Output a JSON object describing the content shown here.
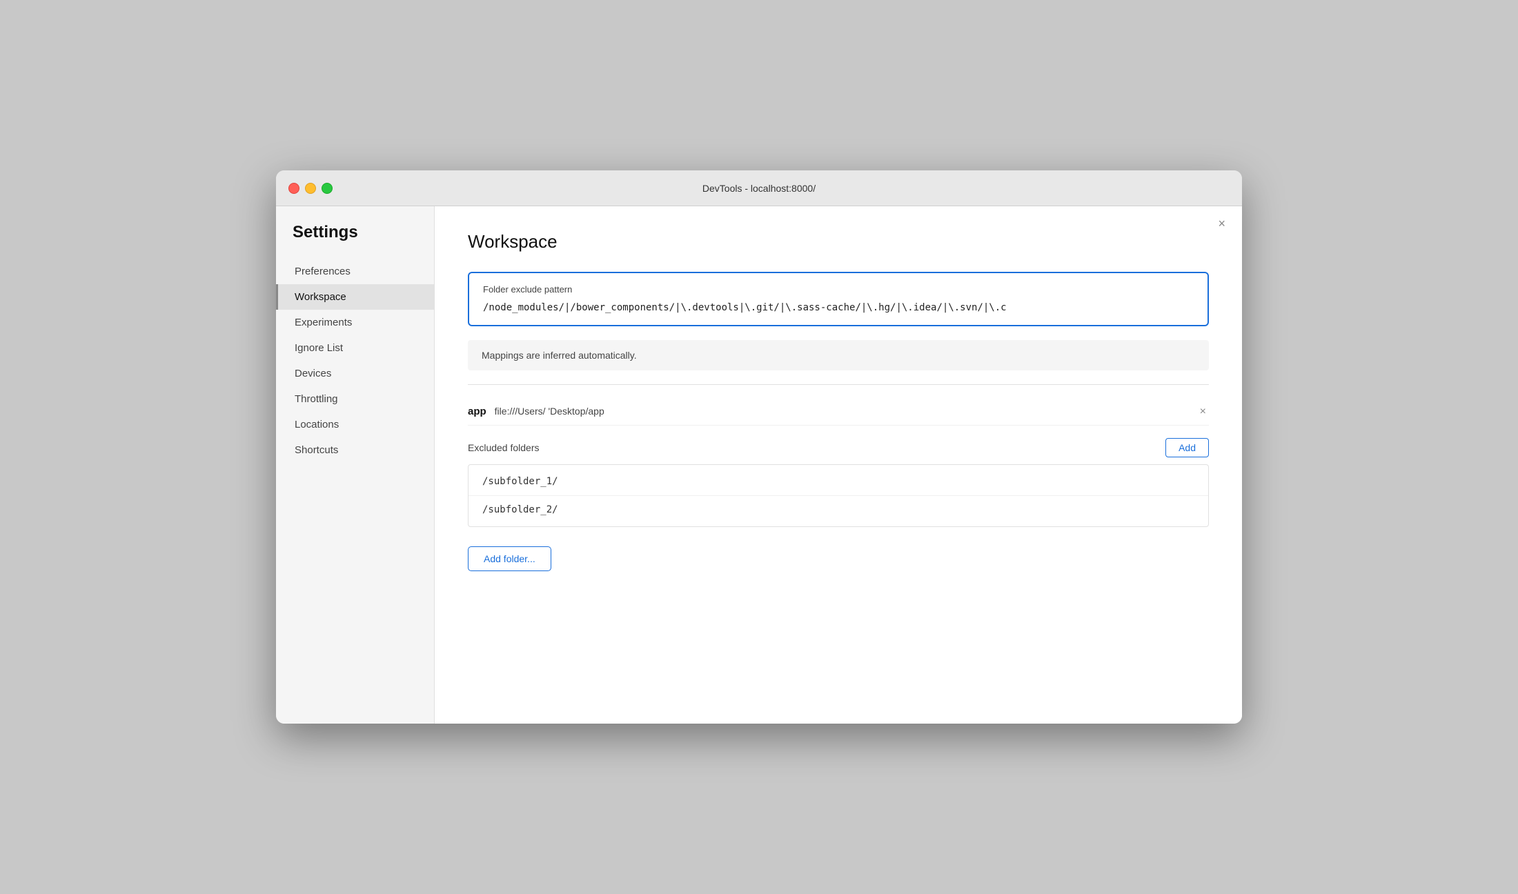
{
  "titlebar": {
    "title": "DevTools - localhost:8000/"
  },
  "sidebar": {
    "heading": "Settings",
    "items": [
      {
        "id": "preferences",
        "label": "Preferences",
        "active": false
      },
      {
        "id": "workspace",
        "label": "Workspace",
        "active": true
      },
      {
        "id": "experiments",
        "label": "Experiments",
        "active": false
      },
      {
        "id": "ignore-list",
        "label": "Ignore List",
        "active": false
      },
      {
        "id": "devices",
        "label": "Devices",
        "active": false
      },
      {
        "id": "throttling",
        "label": "Throttling",
        "active": false
      },
      {
        "id": "locations",
        "label": "Locations",
        "active": false
      },
      {
        "id": "shortcuts",
        "label": "Shortcuts",
        "active": false
      }
    ]
  },
  "main": {
    "title": "Workspace",
    "close_label": "×",
    "folder_exclude": {
      "label": "Folder exclude pattern",
      "value": "/node_modules/|/bower_components/|\\.devtools|\\.git/|\\.sass-cache/|\\.hg/|\\.idea/|\\.svn/|\\.c"
    },
    "mappings_info": "Mappings are inferred automatically.",
    "folder_entry": {
      "name": "app",
      "path": "file:///Users/      'Desktop/app",
      "remove_label": "×"
    },
    "excluded_folders": {
      "label": "Excluded folders",
      "add_label": "Add"
    },
    "subfolders": [
      {
        "path": "/subfolder_1/"
      },
      {
        "path": "/subfolder_2/"
      }
    ],
    "add_folder_label": "Add folder..."
  },
  "colors": {
    "accent_blue": "#1a6fdb"
  }
}
